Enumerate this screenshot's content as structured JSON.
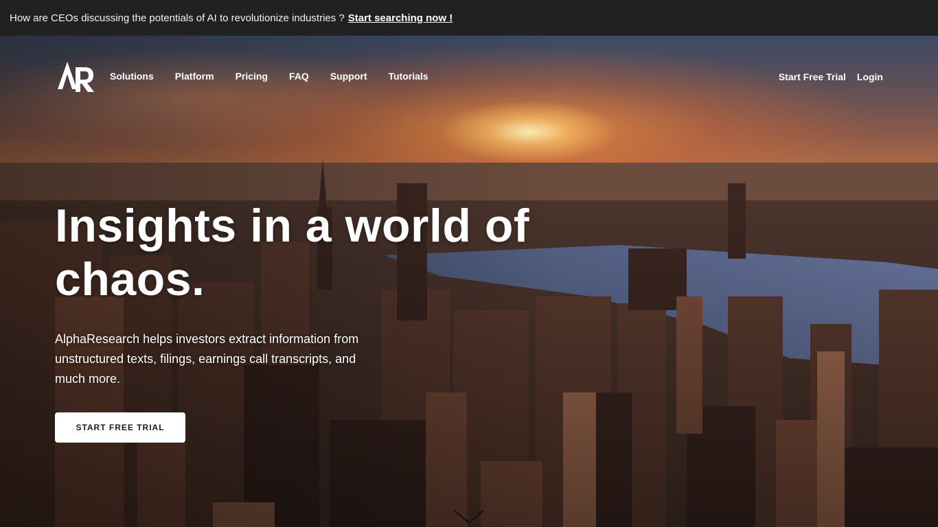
{
  "banner": {
    "text": "How are CEOs discussing the potentials of AI to revolutionize industries ?",
    "link": "Start searching now !"
  },
  "brand": {
    "logo_icon": "ar-logo-icon"
  },
  "nav": {
    "items": [
      "Solutions",
      "Platform",
      "Pricing",
      "FAQ",
      "Support",
      "Tutorials"
    ],
    "trial": "Start Free Trial",
    "login": "Login"
  },
  "hero": {
    "headline": "Insights in a world of chaos.",
    "subtext": "AlphaResearch helps investors extract information from unstructured texts, filings, earnings call transcripts, and much more.",
    "button": "START FREE TRIAL",
    "scroll_icon": "chevron-down-icon"
  },
  "colors": {
    "banner_bg": "#212121",
    "button_bg": "#ffffff",
    "button_text": "#1a1a1a"
  }
}
